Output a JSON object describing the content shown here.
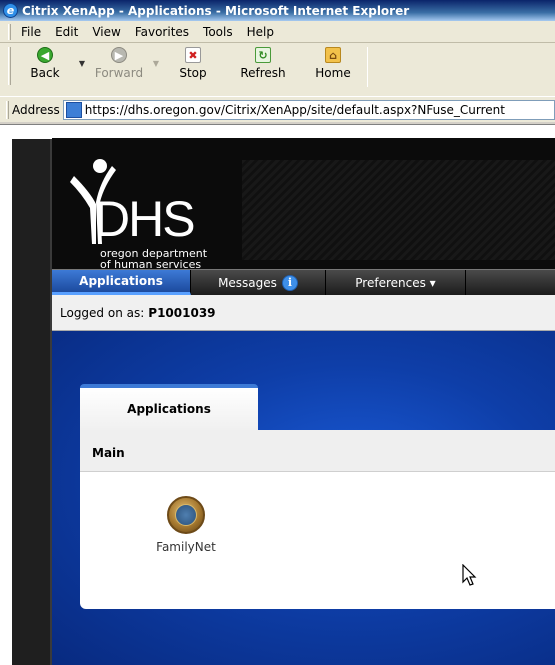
{
  "window": {
    "title": "Citrix XenApp - Applications - Microsoft Internet Explorer"
  },
  "menu": [
    "File",
    "Edit",
    "View",
    "Favorites",
    "Tools",
    "Help"
  ],
  "toolbar": {
    "back": "Back",
    "forward": "Forward",
    "stop": "Stop",
    "refresh": "Refresh",
    "home": "Home"
  },
  "address": {
    "label": "Address",
    "url": "https://dhs.oregon.gov/Citrix/XenApp/site/default.aspx?NFuse_Current"
  },
  "logo": {
    "name": "DHS",
    "line1": "oregon department",
    "line2": "of human services"
  },
  "nav": {
    "applications": "Applications",
    "messages": "Messages",
    "messages_badge": "i",
    "preferences": "Preferences ▾"
  },
  "session": {
    "label": "Logged on as:",
    "user": "P1001039"
  },
  "panel": {
    "tab": "Applications",
    "header": "Main",
    "apps": [
      {
        "name": "FamilyNet",
        "icon": "seal-icon"
      }
    ]
  },
  "colors": {
    "accent": "#3d7ad6",
    "main_bg": "#0e3ea8",
    "banner_bg": "#0b0b0b"
  }
}
